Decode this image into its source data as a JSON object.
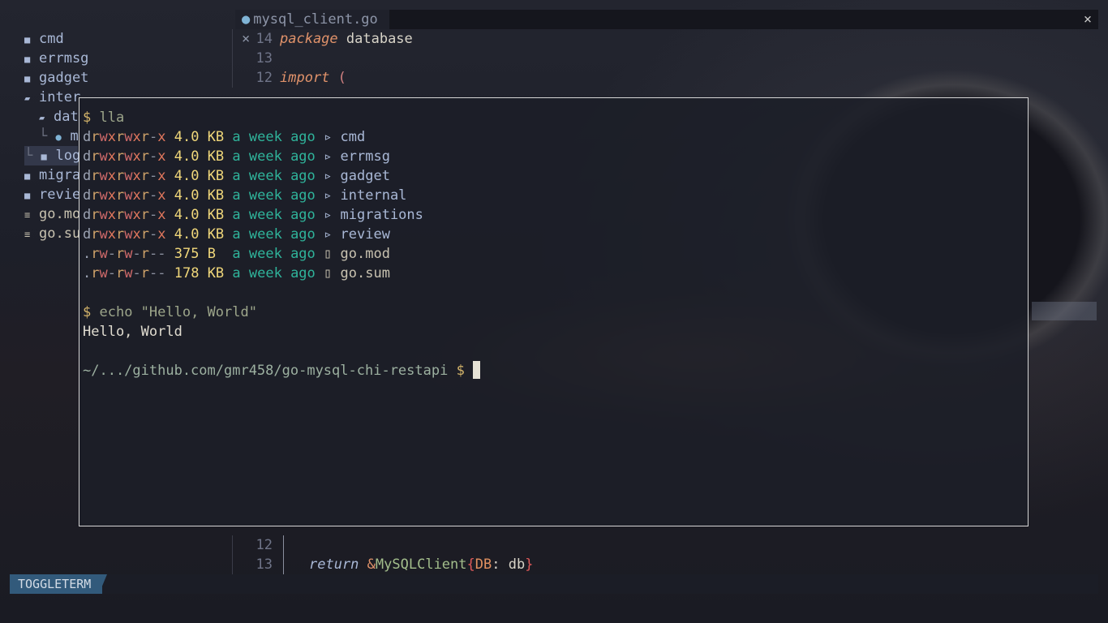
{
  "sidebar": {
    "items": [
      {
        "label": "cmd",
        "icon": "folder-closed-icon"
      },
      {
        "label": "errmsg",
        "icon": "folder-closed-icon"
      },
      {
        "label": "gadget",
        "icon": "folder-closed-icon"
      },
      {
        "label": "inter",
        "icon": "folder-open-icon"
      },
      {
        "label": "dat",
        "icon": "folder-open-icon"
      },
      {
        "label": "m",
        "icon": "go-file-icon"
      },
      {
        "label": "log",
        "icon": "folder-closed-icon"
      },
      {
        "label": "migra",
        "icon": "folder-closed-icon"
      },
      {
        "label": "revie",
        "icon": "folder-closed-icon"
      },
      {
        "label": "go.mo",
        "icon": "text-file-icon"
      },
      {
        "label": "go.su",
        "icon": "text-file-icon"
      }
    ]
  },
  "tab": {
    "filename": "mysql_client.go",
    "close_glyph": "×"
  },
  "window": {
    "close_glyph": "×"
  },
  "editor_top": [
    {
      "num": "14",
      "keyword": "package",
      "text": " database"
    },
    {
      "num": "13",
      "keyword": "",
      "text": ""
    },
    {
      "num": "12",
      "keyword": "import",
      "text": " ("
    }
  ],
  "editor_bottom": [
    {
      "num": "12",
      "text": ""
    },
    {
      "num": "13",
      "keyword": "return",
      "amp": "&",
      "type": "MySQLClient",
      "open": "{",
      "field": "DB",
      "colon": ": ",
      "value": "db",
      "close": "}"
    }
  ],
  "terminal": {
    "prompt": "$",
    "cmd1": "lla",
    "listing": [
      {
        "perm_d": "d",
        "r1": "r",
        "w1": "w",
        "x1": "x",
        "r2": "r",
        "w2": "w",
        "x2": "x",
        "r3": "r",
        "d3": "-",
        "x3": "x",
        "size": "4.0 KB",
        "time": "a week ago",
        "icon": "▹",
        "name": "cmd"
      },
      {
        "perm_d": "d",
        "r1": "r",
        "w1": "w",
        "x1": "x",
        "r2": "r",
        "w2": "w",
        "x2": "x",
        "r3": "r",
        "d3": "-",
        "x3": "x",
        "size": "4.0 KB",
        "time": "a week ago",
        "icon": "▹",
        "name": "errmsg"
      },
      {
        "perm_d": "d",
        "r1": "r",
        "w1": "w",
        "x1": "x",
        "r2": "r",
        "w2": "w",
        "x2": "x",
        "r3": "r",
        "d3": "-",
        "x3": "x",
        "size": "4.0 KB",
        "time": "a week ago",
        "icon": "▹",
        "name": "gadget"
      },
      {
        "perm_d": "d",
        "r1": "r",
        "w1": "w",
        "x1": "x",
        "r2": "r",
        "w2": "w",
        "x2": "x",
        "r3": "r",
        "d3": "-",
        "x3": "x",
        "size": "4.0 KB",
        "time": "a week ago",
        "icon": "▹",
        "name": "internal"
      },
      {
        "perm_d": "d",
        "r1": "r",
        "w1": "w",
        "x1": "x",
        "r2": "r",
        "w2": "w",
        "x2": "x",
        "r3": "r",
        "d3": "-",
        "x3": "x",
        "size": "4.0 KB",
        "time": "a week ago",
        "icon": "▹",
        "name": "migrations"
      },
      {
        "perm_d": "d",
        "r1": "r",
        "w1": "w",
        "x1": "x",
        "r2": "r",
        "w2": "w",
        "x2": "x",
        "r3": "r",
        "d3": "-",
        "x3": "x",
        "size": "4.0 KB",
        "time": "a week ago",
        "icon": "▹",
        "name": "review"
      },
      {
        "perm_d": ".",
        "r1": "r",
        "w1": "w",
        "x1": "-",
        "r2": "r",
        "w2": "w",
        "x2": "-",
        "r3": "r",
        "d3": "-",
        "x3": "-",
        "size": "375 B ",
        "time": "a week ago",
        "icon": "▯",
        "name": "go.mod"
      },
      {
        "perm_d": ".",
        "r1": "r",
        "w1": "w",
        "x1": "-",
        "r2": "r",
        "w2": "w",
        "x2": "-",
        "r3": "r",
        "d3": "-",
        "x3": "-",
        "size": "178 KB",
        "time": "a week ago",
        "icon": "▯",
        "name": "go.sum"
      }
    ],
    "cmd2": "echo \"Hello, World\"",
    "output": "Hello, World",
    "cwd": "~/.../github.com/gmr458/go-mysql-chi-restapi"
  },
  "statusbar": {
    "mode": "TOGGLETERM"
  },
  "colors": {
    "accent": "#325a7b",
    "keyword": "#e0926a",
    "type": "#a3be8c"
  }
}
